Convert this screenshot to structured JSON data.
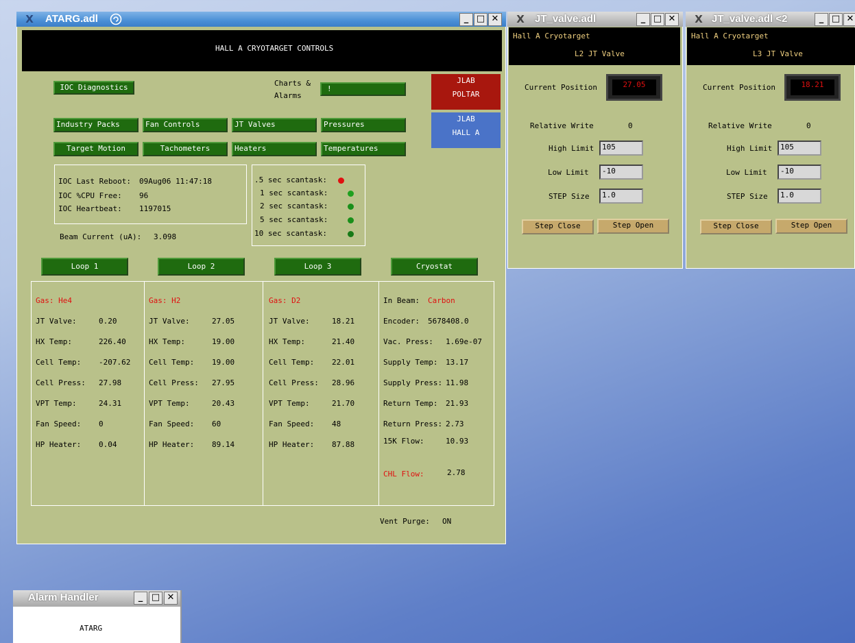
{
  "main_window": {
    "title": "ATARG.adl",
    "banner": "HALL A CRYOTARGET CONTROLS",
    "ioc_diagnostics": "IOC Diagnostics",
    "charts_alarms_line1": "Charts &",
    "charts_alarms_line2": "Alarms",
    "charts_alarms_button": "!",
    "jlab_poltar_line1": "JLAB",
    "jlab_poltar_line2": "POLTAR",
    "jlab_halla_line1": "JLAB",
    "jlab_halla_line2": "HALL A",
    "nav_row1": [
      "Industry Packs",
      "Fan Controls",
      "JT Valves",
      "Pressures"
    ],
    "nav_row2": [
      "Target Motion",
      "Tachometers",
      "Heaters",
      "Temperatures"
    ],
    "ioc": {
      "last_reboot_label": "IOC Last Reboot:",
      "last_reboot_value": "09Aug06 11:47:18",
      "cpu_free_label": "IOC %CPU Free:",
      "cpu_free_value": "96",
      "heartbeat_label": "IOC Heartbeat:",
      "heartbeat_value": "1197015"
    },
    "scantasks": [
      {
        "label": ".5 sec scantask:",
        "status_color": "#e01010"
      },
      {
        "label": "1 sec scantask:",
        "status_color": "#1fa01f"
      },
      {
        "label": "2 sec scantask:",
        "status_color": "#1a8f1a"
      },
      {
        "label": "5 sec scantask:",
        "status_color": "#1a8f1a"
      },
      {
        "label": "10 sec scantask:",
        "status_color": "#177a17"
      }
    ],
    "beam_current_label": "Beam Current (uA):",
    "beam_current_value": "3.098",
    "loop_buttons": [
      "Loop 1",
      "Loop 2",
      "Loop 3",
      "Cryostat"
    ],
    "loops": [
      {
        "gas": "Gas: He4",
        "rows": [
          {
            "label": "JT Valve:",
            "value": "0.20"
          },
          {
            "label": "HX Temp:",
            "value": "226.40"
          },
          {
            "label": "Cell Temp:",
            "value": "-207.62"
          },
          {
            "label": "Cell Press:",
            "value": "27.98"
          },
          {
            "label": "VPT Temp:",
            "value": "24.31"
          },
          {
            "label": "Fan Speed:",
            "value": "0"
          },
          {
            "label": "HP Heater:",
            "value": "0.04"
          }
        ]
      },
      {
        "gas": "Gas: H2",
        "rows": [
          {
            "label": "JT Valve:",
            "value": "27.05"
          },
          {
            "label": "HX Temp:",
            "value": "19.00"
          },
          {
            "label": "Cell Temp:",
            "value": "19.00"
          },
          {
            "label": "Cell Press:",
            "value": "27.95"
          },
          {
            "label": "VPT Temp:",
            "value": "20.43"
          },
          {
            "label": "Fan Speed:",
            "value": "60"
          },
          {
            "label": "HP Heater:",
            "value": "89.14"
          }
        ]
      },
      {
        "gas": "Gas: D2",
        "rows": [
          {
            "label": "JT Valve:",
            "value": "18.21"
          },
          {
            "label": "HX Temp:",
            "value": "21.40"
          },
          {
            "label": "Cell Temp:",
            "value": "22.01"
          },
          {
            "label": "Cell Press:",
            "value": "28.96"
          },
          {
            "label": "VPT Temp:",
            "value": "21.70"
          },
          {
            "label": "Fan Speed:",
            "value": "48"
          },
          {
            "label": "HP Heater:",
            "value": "87.88"
          }
        ]
      }
    ],
    "cryostat": {
      "in_beam_label": "In Beam:",
      "in_beam_value": "Carbon",
      "rows": [
        {
          "label": "Encoder:",
          "value": "5678408.0"
        },
        {
          "label": "Vac. Press:",
          "value": "1.69e-07"
        },
        {
          "label": "Supply Temp:",
          "value": "13.17"
        },
        {
          "label": "Supply Press:",
          "value": "11.98"
        },
        {
          "label": "Return Temp:",
          "value": "21.93"
        },
        {
          "label": "Return Press:",
          "value": "2.73"
        },
        {
          "label": "15K Flow:",
          "value": "10.93"
        }
      ],
      "chl_flow_label": "CHL Flow:",
      "chl_flow_value": "2.78"
    },
    "vent_purge_label": "Vent Purge:",
    "vent_purge_value": "ON"
  },
  "jt_windows": [
    {
      "title": "JT_valve.adl",
      "header": "Hall A Cryotarget",
      "subheader": "L2 JT Valve",
      "current_position_label": "Current Position",
      "current_position_value": "27.05",
      "relative_write_label": "Relative Write",
      "relative_write_value": "0",
      "high_limit_label": "High Limit",
      "high_limit_value": "105",
      "low_limit_label": "Low Limit",
      "low_limit_value": "-10",
      "step_size_label": "STEP Size",
      "step_size_value": "1.0",
      "step_close": "Step Close",
      "step_open": "Step Open"
    },
    {
      "title": "JT_valve.adl <2",
      "header": "Hall A Cryotarget",
      "subheader": "L3 JT Valve",
      "current_position_label": "Current Position",
      "current_position_value": "18.21",
      "relative_write_label": "Relative Write",
      "relative_write_value": "0",
      "high_limit_label": "High Limit",
      "high_limit_value": "105",
      "low_limit_label": "Low Limit",
      "low_limit_value": "-10",
      "step_size_label": "STEP Size",
      "step_size_value": "1.0",
      "step_close": "Step Close",
      "step_open": "Step Open"
    }
  ],
  "alarm_window": {
    "title": "Alarm Handler",
    "content": "ATARG"
  },
  "window_controls": {
    "minimize": "_",
    "maximize": "□",
    "close": "✕",
    "app_icon": "X"
  }
}
